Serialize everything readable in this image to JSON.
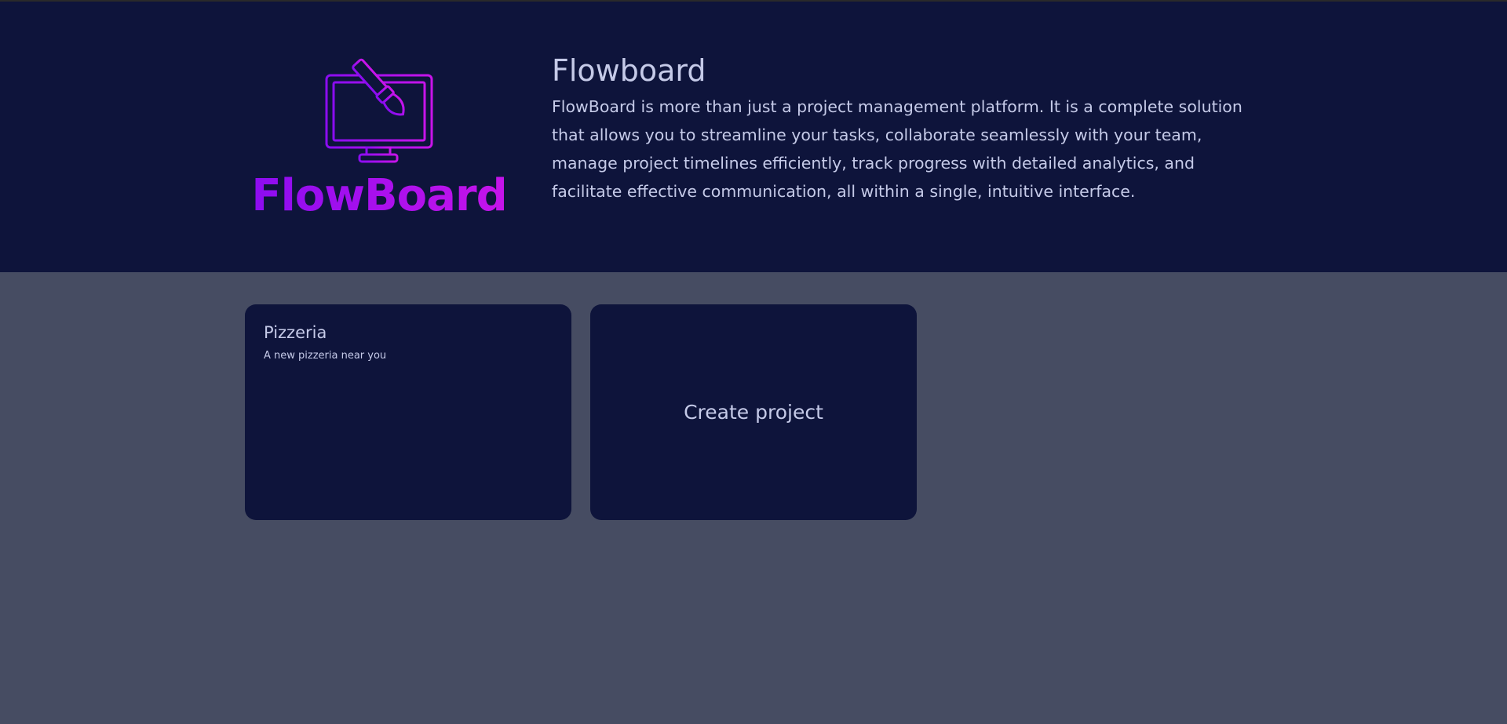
{
  "brand": {
    "logo_text": "FlowBoard",
    "logo_icon": "monitor-paintbrush-icon",
    "logo_color_start": "#8a0cf0",
    "logo_color_end": "#c814ea"
  },
  "hero": {
    "title": "Flowboard",
    "description": "FlowBoard is more than just a project management platform. It is a complete solution that allows you to streamline your tasks, collaborate seamlessly with your team, manage project timelines efficiently, track progress with detailed analytics, and facilitate effective communication, all within a single, intuitive interface."
  },
  "projects": [
    {
      "name": "Pizzeria",
      "description": "A new pizzeria near you"
    }
  ],
  "create_card": {
    "label": "Create project"
  },
  "colors": {
    "header_bg": "#0e143b",
    "page_bg": "#464c62",
    "card_bg": "#0e143b",
    "text": "#c5cae8"
  }
}
